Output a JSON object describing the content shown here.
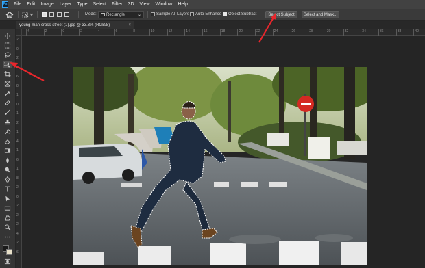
{
  "app": {
    "logo_text": "Ps"
  },
  "menu": [
    "File",
    "Edit",
    "Image",
    "Layer",
    "Type",
    "Select",
    "Filter",
    "3D",
    "View",
    "Window",
    "Help"
  ],
  "options": {
    "mode_label": "Mode:",
    "mode_value": "Rectangle",
    "sample_all_layers": "Sample All Layers",
    "sample_all_layers_checked": false,
    "auto_enhance": "Auto-Enhance",
    "auto_enhance_checked": false,
    "object_subtract": "Object Subtract",
    "object_subtract_checked": true,
    "select_subject": "Select Subject",
    "select_and_mask": "Select and Mask..."
  },
  "document": {
    "tab_title": "young-man-cross-street (1).jpg @ 33.3% (RGB/8)",
    "close_glyph": "×"
  },
  "rulers": {
    "horizontal": [
      "4",
      "2",
      "0",
      "2",
      "4",
      "6",
      "8",
      "10",
      "12",
      "14",
      "16",
      "18",
      "20",
      "22",
      "24",
      "26",
      "28",
      "30",
      "32",
      "34",
      "36",
      "38",
      "40"
    ],
    "vertical": [
      "2",
      "0",
      "2",
      "4",
      "6",
      "8",
      "1",
      "0",
      "1",
      "2",
      "1",
      "4",
      "1",
      "6",
      "1",
      "8",
      "2",
      "0",
      "2",
      "2",
      "2",
      "4",
      "2",
      "6"
    ]
  },
  "tools": [
    "move-tool",
    "marquee-tool",
    "lasso-tool",
    "object-selection-tool",
    "crop-tool",
    "frame-tool",
    "eyedropper-tool",
    "healing-brush-tool",
    "brush-tool",
    "clone-stamp-tool",
    "history-brush-tool",
    "eraser-tool",
    "gradient-tool",
    "blur-tool",
    "dodge-tool",
    "pen-tool",
    "type-tool",
    "path-selection-tool",
    "rectangle-tool",
    "hand-tool",
    "zoom-tool",
    "extra-tools"
  ],
  "colors": {
    "foreground": "#1a1a1a",
    "background": "#e8e0c8",
    "annotation_arrow": "#e8262c"
  }
}
